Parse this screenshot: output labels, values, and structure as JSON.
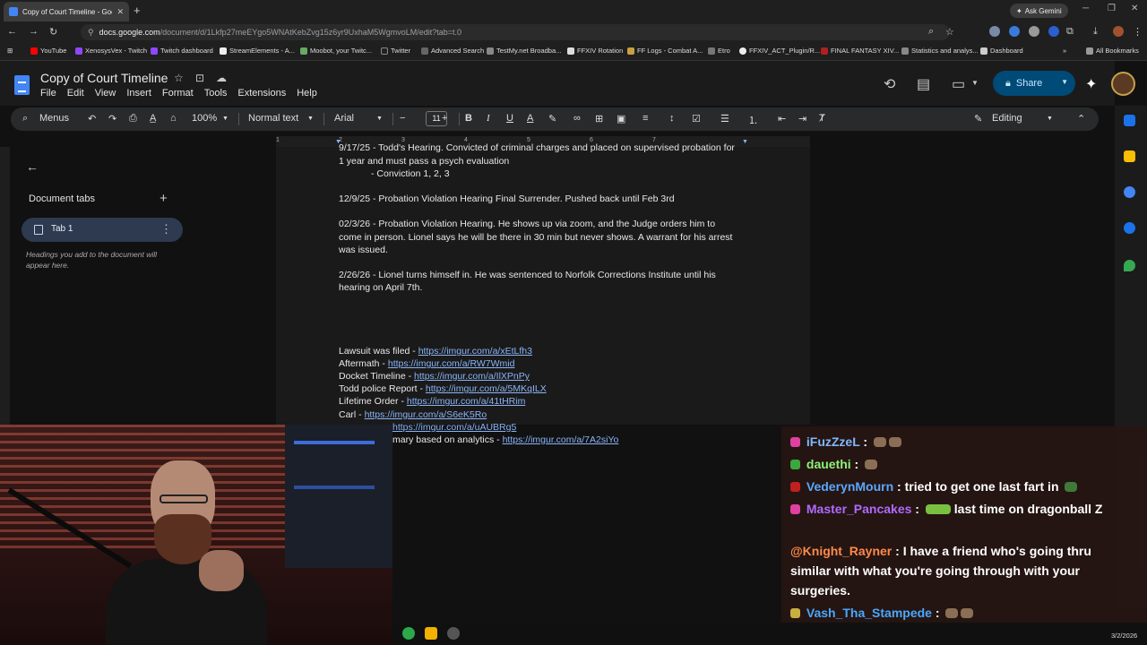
{
  "browser": {
    "tab_title": "Copy of Court Timeline - Goog",
    "tab_close": "✕",
    "new_tab": "+",
    "ask_gemini": "Ask Gemini",
    "url_host": "docs.google.com",
    "url_path": "/document/d/1Lkfp27meEYgo5WNAtKebZvg15z6yr9UxhaM5WgmvoLM/edit?tab=t.0",
    "bookmarks": [
      "YouTube",
      "XenosysVex - Twitch",
      "Twitch dashboard",
      "StreamElements - A...",
      "Moobot, your Twitc...",
      "Twitter",
      "Advanced Search",
      "TestMy.net Broadba...",
      "FFXIV Rotation",
      "FF Logs - Combat A...",
      "Etro",
      "FFXIV_ACT_Plugin/R...",
      "FINAL FANTASY XIV...",
      "Statistics and analys...",
      "Dashboard"
    ],
    "all_bookmarks": "All Bookmarks"
  },
  "docs": {
    "title": "Copy of Court Timeline",
    "menu": [
      "File",
      "Edit",
      "View",
      "Insert",
      "Format",
      "Tools",
      "Extensions",
      "Help"
    ],
    "share_label": "Share",
    "toolbar": {
      "menus": "Menus",
      "zoom": "100%",
      "style": "Normal text",
      "font": "Arial",
      "font_size": "11",
      "mode": "Editing"
    },
    "ruler_ticks": [
      "1",
      "2",
      "3",
      "4",
      "5",
      "6",
      "7"
    ],
    "tabs_panel": {
      "heading": "Document tabs",
      "tab_label": "Tab 1",
      "hint": "Headings you add to the document will appear here."
    }
  },
  "document": {
    "para1_line1": "9/17/25 - Todd's Hearing. Convicted of criminal charges and placed on supervised probation for",
    "para1_line2": "1 year and must pass a psych evaluation",
    "para1_line3": "- Conviction 1, 2, 3",
    "para2": "12/9/25 - Probation Violation Hearing Final Surrender. Pushed back until Feb 3rd",
    "para3_line1": "02/3/26 - Probation Violation Hearing. He shows up via zoom, and the Judge orders him to",
    "para3_line2": "come in person. Lionel says he will be there in 30 min but never shows. A warrant for his arrest",
    "para3_line3": "was issued.",
    "para4_line1": "2/26/26 - Lionel turns himself in. He was sentenced to Norfolk Corrections Institute until his",
    "para4_line2": "hearing on April 7th.",
    "links": [
      {
        "label": "Lawsuit was filed - ",
        "url": "https://imgur.com/a/xEtLfh3"
      },
      {
        "label": "Aftermath - ",
        "url": "https://imgur.com/a/RW7Wmid"
      },
      {
        "label": "Docket Timeline - ",
        "url": "https://imgur.com/a/IlXPnPy"
      },
      {
        "label": "Todd police Report - ",
        "url": "https://imgur.com/a/5MKqILX"
      },
      {
        "label": "Lifetime Order - ",
        "url": "https://imgur.com/a/41tHRim"
      },
      {
        "label": "Carl - ",
        "url": "https://imgur.com/a/S6eK5Ro"
      },
      {
        "label": "",
        "url": "https://imgur.com/a/uAUBRg5"
      },
      {
        "label": "mary based on analytics - ",
        "url": "https://imgur.com/a/7A2siYo"
      }
    ]
  },
  "chat": [
    {
      "user": "iFuzZzeL",
      "color": "#7fb8ff",
      "badge": "#e040a0",
      "text": ""
    },
    {
      "user": "dauethi",
      "color": "#8ef07a",
      "badge": "#3ca83c",
      "text": ""
    },
    {
      "user": "VederynMourn",
      "color": "#5aa8ff",
      "badge": "#c02020",
      "text": "tried to get one last fart in"
    },
    {
      "user": "Master_Pancakes",
      "color": "#b06aff",
      "badge": "#e040a0",
      "text": "last time on dragonball Z"
    },
    {
      "user": "@Knight_Rayner",
      "color": "#ff8a4a",
      "badge": "",
      "text": "I have a friend who's going thru similar with what you're going through with your surgeries."
    },
    {
      "user": "Vash_Tha_Stampede",
      "color": "#4aa8ff",
      "badge": "#c8b040",
      "text": ""
    }
  ],
  "taskbar": {
    "date": "3/2/2026"
  }
}
